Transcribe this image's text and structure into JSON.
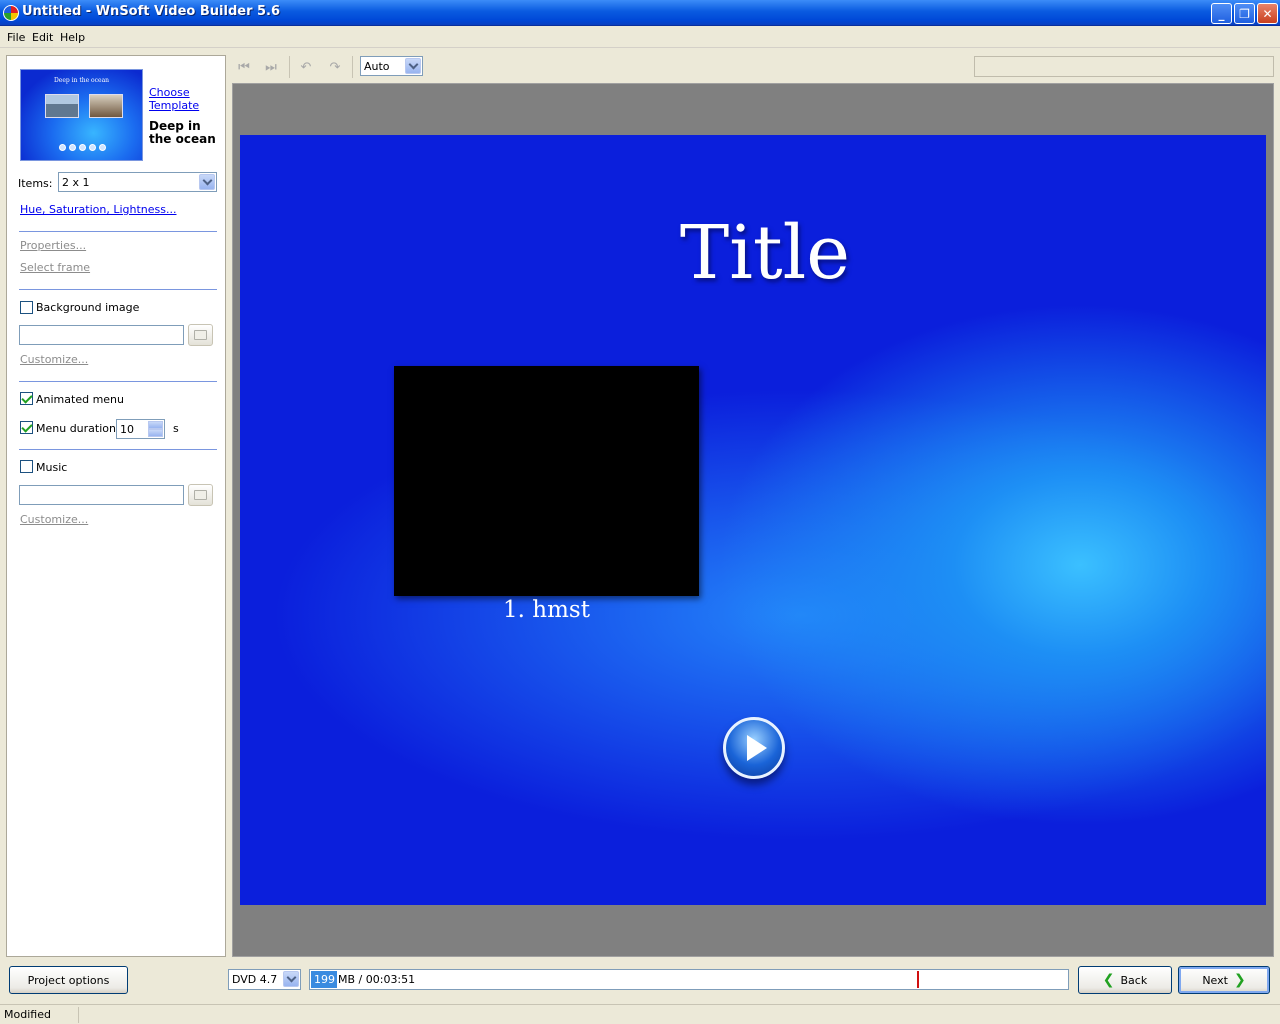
{
  "window": {
    "title": "Untitled - WnSoft Video Builder 5.6"
  },
  "menu": [
    "File",
    "Edit",
    "Help"
  ],
  "left_panel": {
    "template_thumbnail": {
      "title": "Deep in the ocean"
    },
    "choose_template_link": "Choose Template",
    "template_name": "Deep in the ocean",
    "items_label": "Items:",
    "items_value": "2 x 1",
    "hue_link": "Hue, Saturation, Lightness...",
    "properties_link": "Properties...",
    "select_frame_link": "Select frame",
    "background_image_label": "Background image",
    "background_image_checked": false,
    "background_customize_link": "Customize...",
    "animated_menu_label": "Animated menu",
    "animated_menu_checked": true,
    "menu_duration_label": "Menu duration",
    "menu_duration_checked": true,
    "menu_duration_value": "10",
    "menu_duration_unit": "s",
    "music_label": "Music",
    "music_checked": false,
    "music_customize_link": "Customize..."
  },
  "toolbar": {
    "zoom_value": "Auto",
    "icons": [
      "step-back-icon",
      "step-forward-icon",
      "undo-icon",
      "redo-icon"
    ]
  },
  "preview": {
    "title": "Title",
    "item_label": "1. hmst",
    "colors": {
      "background": "#0b1fdc",
      "glow": "#3bc0ff"
    }
  },
  "bottom": {
    "project_options_label": "Project options",
    "disc_value": "DVD 4.7",
    "used_mb": "199",
    "size_text": "MB / 00:03:51",
    "usage_fraction": 0.035,
    "back_label": "Back",
    "next_label": "Next"
  },
  "status": {
    "text": "Modified"
  }
}
